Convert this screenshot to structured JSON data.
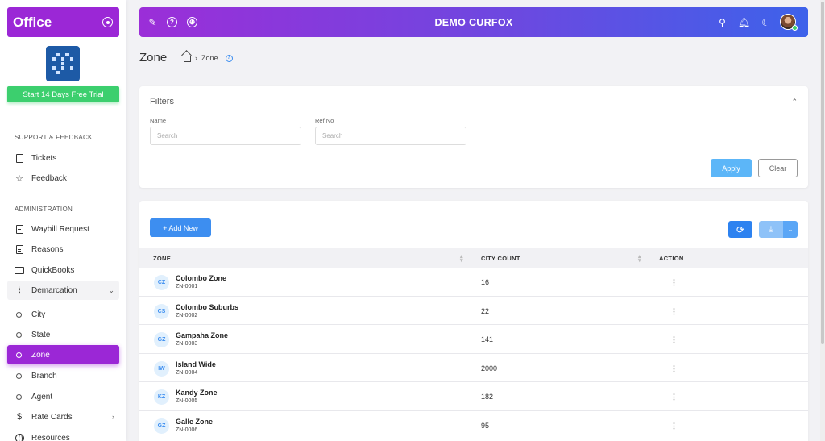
{
  "sidebar": {
    "brand": "Office",
    "trial_label": "Start 14 Days Free Trial",
    "sections": {
      "support": "SUPPORT & FEEDBACK",
      "admin": "ADMINISTRATION"
    },
    "support_items": [
      "Tickets",
      "Feedback"
    ],
    "admin_items": [
      "Waybill Request",
      "Reasons",
      "QuickBooks",
      "Demarcation"
    ],
    "demarcation_children": [
      "City",
      "State",
      "Zone",
      "Branch",
      "Agent"
    ],
    "more_items": [
      "Rate Cards",
      "Resources"
    ],
    "active_item": "Zone"
  },
  "header": {
    "title": "DEMO CURFOX",
    "left_icons": [
      "brush-icon",
      "help-icon",
      "globe-icon"
    ],
    "right_icons": [
      "search-icon",
      "bell-icon",
      "moon-icon",
      "avatar"
    ]
  },
  "page": {
    "title": "Zone",
    "breadcrumb": "Zone"
  },
  "filters": {
    "title": "Filters",
    "name_label": "Name",
    "name_placeholder": "Search",
    "ref_label": "Ref No",
    "ref_placeholder": "Search",
    "apply_label": "Apply",
    "clear_label": "Clear"
  },
  "table": {
    "add_label": "+ Add New",
    "columns": [
      "ZONE",
      "CITY COUNT",
      "ACTION"
    ],
    "rows": [
      {
        "initials": "CZ",
        "name": "Colombo Zone",
        "ref": "ZN-0001",
        "count": "16"
      },
      {
        "initials": "CS",
        "name": "Colombo Suburbs",
        "ref": "ZN-0002",
        "count": "22"
      },
      {
        "initials": "GZ",
        "name": "Gampaha Zone",
        "ref": "ZN-0003",
        "count": "141"
      },
      {
        "initials": "IW",
        "name": "Island Wide",
        "ref": "ZN-0004",
        "count": "2000"
      },
      {
        "initials": "KZ",
        "name": "Kandy Zone",
        "ref": "ZN-0005",
        "count": "182"
      },
      {
        "initials": "GZ",
        "name": "Galle Zone",
        "ref": "ZN-0006",
        "count": "95"
      }
    ]
  },
  "colors": {
    "brand_purple": "#9b27d6",
    "primary_blue": "#3d8ef0",
    "trial_green": "#3ccf6e"
  }
}
